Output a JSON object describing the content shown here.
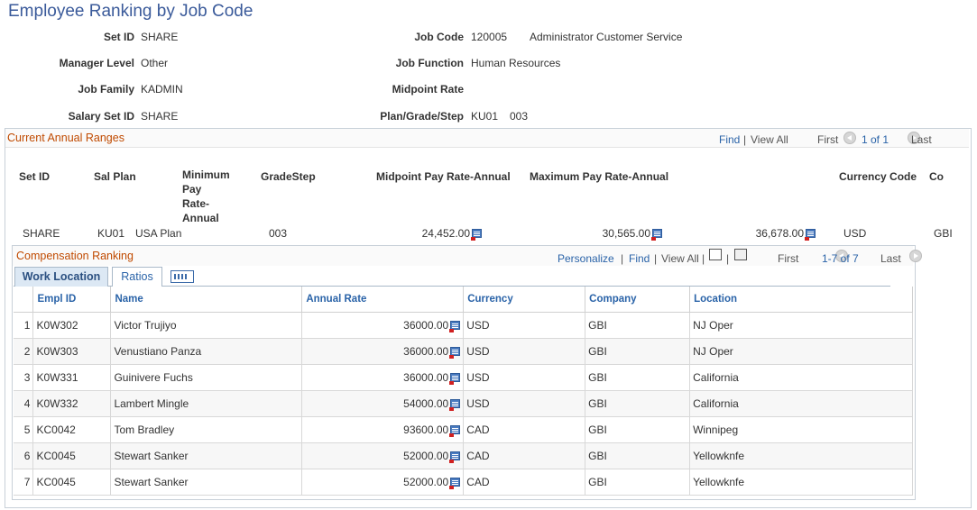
{
  "page": {
    "title": "Employee Ranking by Job Code"
  },
  "header": {
    "set_id_label": "Set ID",
    "set_id": "SHARE",
    "manager_level_label": "Manager Level",
    "manager_level": "Other",
    "job_family_label": "Job Family",
    "job_family": "KADMIN",
    "salary_set_id_label": "Salary Set ID",
    "salary_set_id": "SHARE",
    "job_code_label": "Job Code",
    "job_code": "120005",
    "job_code_desc": "Administrator Customer Service",
    "job_function_label": "Job Function",
    "job_function": "Human Resources",
    "midpoint_rate_label": "Midpoint Rate",
    "plan_grade_step_label": "Plan/Grade/Step",
    "plan": "KU01",
    "step": "003"
  },
  "ranges": {
    "title": "Current Annual Ranges",
    "find": "Find",
    "view_all": "View All",
    "first": "First",
    "page": "1 of 1",
    "last": "Last",
    "columns": {
      "set_id": "Set ID",
      "sal_plan": "Sal Plan",
      "min_1": "Minimum",
      "min_2": "Pay",
      "min_3": "Rate-",
      "min_4": "Annual",
      "grade_step": "GradeStep",
      "midpoint": "Midpoint Pay Rate-Annual",
      "maximum": "Maximum Pay Rate-Annual",
      "currency": "Currency Code",
      "co": "Co"
    },
    "row": {
      "set_id": "SHARE",
      "sal_plan": "KU01",
      "plan_desc": "USA Plan",
      "grade_step": "003",
      "minimum": "24,452.00",
      "midpoint": "30,565.00",
      "maximum": "36,678.00",
      "currency": "USD",
      "company": "GBI"
    }
  },
  "ranking": {
    "title": "Compensation Ranking",
    "personalize": "Personalize",
    "find": "Find",
    "view_all": "View All",
    "first": "First",
    "page": "1-7 of 7",
    "last": "Last",
    "tabs": {
      "work_location": "Work Location",
      "ratios": "Ratios"
    },
    "columns": {
      "empl_id": "Empl ID",
      "name": "Name",
      "annual_rate": "Annual Rate",
      "currency": "Currency",
      "company": "Company",
      "location": "Location"
    },
    "rows": [
      {
        "num": "1",
        "empl_id": "K0W302",
        "name": "Victor Trujiyo",
        "rate": "36000.00",
        "currency": "USD",
        "company": "GBI",
        "location": "NJ Oper"
      },
      {
        "num": "2",
        "empl_id": "K0W303",
        "name": "Venustiano Panza",
        "rate": "36000.00",
        "currency": "USD",
        "company": "GBI",
        "location": "NJ Oper"
      },
      {
        "num": "3",
        "empl_id": "K0W331",
        "name": "Guinivere Fuchs",
        "rate": "36000.00",
        "currency": "USD",
        "company": "GBI",
        "location": "California"
      },
      {
        "num": "4",
        "empl_id": "K0W332",
        "name": "Lambert Mingle",
        "rate": "54000.00",
        "currency": "USD",
        "company": "GBI",
        "location": "California"
      },
      {
        "num": "5",
        "empl_id": "KC0042",
        "name": "Tom Bradley",
        "rate": "93600.00",
        "currency": "CAD",
        "company": "GBI",
        "location": "Winnipeg"
      },
      {
        "num": "6",
        "empl_id": "KC0045",
        "name": "Stewart Sanker",
        "rate": "52000.00",
        "currency": "CAD",
        "company": "GBI",
        "location": "Yellowknfe"
      },
      {
        "num": "7",
        "empl_id": "KC0045",
        "name": "Stewart Sanker",
        "rate": "52000.00",
        "currency": "CAD",
        "company": "GBI",
        "location": "Yellowknfe"
      }
    ]
  }
}
